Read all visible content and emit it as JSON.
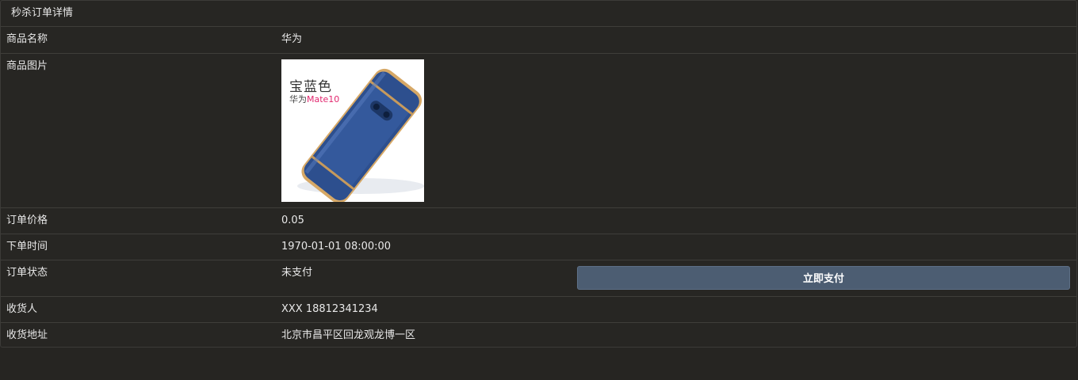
{
  "panel": {
    "title": "秒杀订单详情"
  },
  "rows": {
    "product_name": {
      "label": "商品名称",
      "value": "华为"
    },
    "product_image": {
      "label": "商品图片",
      "image_text_title": "宝蓝色",
      "image_text_sub_prefix": "华为",
      "image_text_sub_model": "Mate10"
    },
    "order_price": {
      "label": "订单价格",
      "value": "0.05"
    },
    "order_time": {
      "label": "下单时间",
      "value": "1970-01-01 08:00:00"
    },
    "order_status": {
      "label": "订单状态",
      "value": "未支付",
      "pay_button_label": "立即支付"
    },
    "receiver": {
      "label": "收货人",
      "value": "XXX 18812341234"
    },
    "address": {
      "label": "收货地址",
      "value": "北京市昌平区回龙观龙博一区"
    }
  },
  "colors": {
    "background": "#262522",
    "button": "#4c5d72",
    "phone_blue": "#2d4f8e",
    "phone_gold": "#d6a866",
    "model_accent": "#e2266e"
  },
  "icons": {
    "product_image": "phone-case-photo"
  }
}
